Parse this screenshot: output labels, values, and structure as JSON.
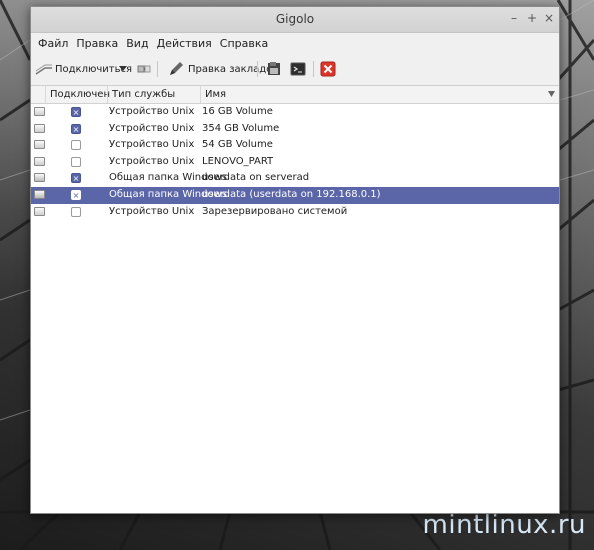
{
  "window": {
    "title": "Gigolo"
  },
  "window_controls": [
    "–",
    "+",
    "×"
  ],
  "menu": [
    "Файл",
    "Правка",
    "Вид",
    "Действия",
    "Справка"
  ],
  "toolbar": {
    "connect_label": "Подключиться",
    "bookmarks_label": "Правка закладок"
  },
  "columns": [
    "Подключен",
    "Тип службы",
    "Имя"
  ],
  "rows": [
    {
      "connected": true,
      "type": "Устройство Unix",
      "name": "16 GB Volume",
      "icon": "drive-icon",
      "selected": false
    },
    {
      "connected": true,
      "type": "Устройство Unix",
      "name": "354 GB Volume",
      "icon": "drive-icon",
      "selected": false
    },
    {
      "connected": false,
      "type": "Устройство Unix",
      "name": "54 GB Volume",
      "icon": "drive-icon",
      "selected": false
    },
    {
      "connected": false,
      "type": "Устройство Unix",
      "name": "LENOVO_PART",
      "icon": "drive-icon",
      "selected": false
    },
    {
      "connected": true,
      "type": "Общая папка Windows",
      "name": "userdata on serverad",
      "icon": "network-share-icon",
      "selected": false
    },
    {
      "connected": true,
      "type": "Общая папка Windows",
      "name": "userdata (userdata on 192.168.0.1)",
      "icon": "network-share-icon",
      "selected": true
    },
    {
      "connected": false,
      "type": "Устройство Unix",
      "name": "Зарезервировано системой",
      "icon": "drive-icon",
      "selected": false
    }
  ],
  "watermark": "mintlinux.ru",
  "colors": {
    "selection": "#5b66a8",
    "close_button": "#d9352a"
  }
}
